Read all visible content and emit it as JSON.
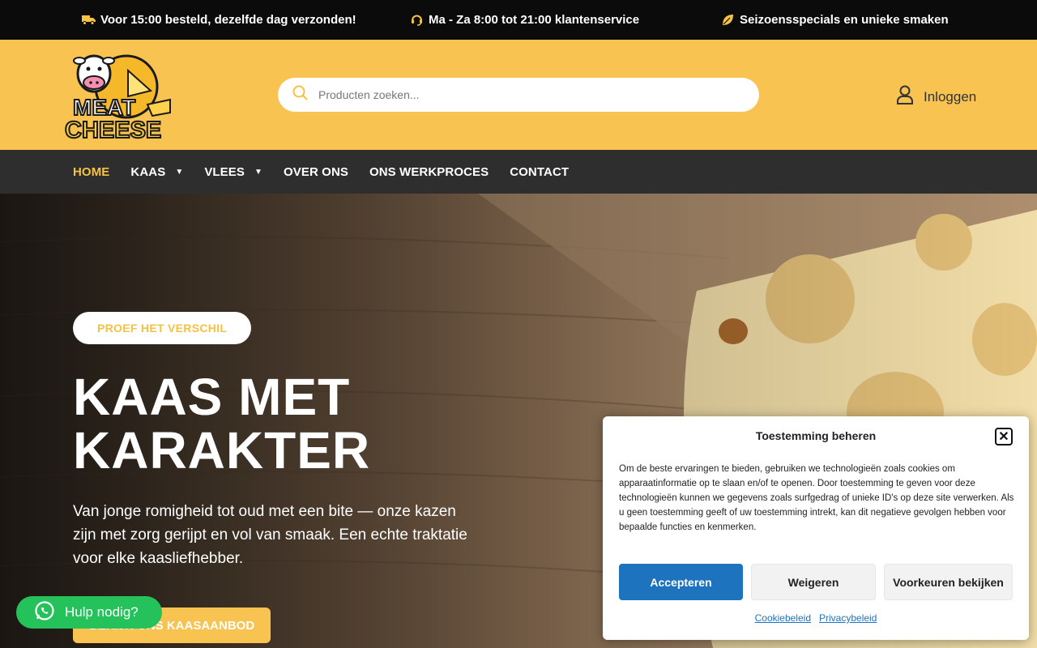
{
  "topbar": {
    "items": [
      {
        "icon": "truck-icon",
        "text": "Voor 15:00 besteld, dezelfde dag verzonden!"
      },
      {
        "icon": "headset-icon",
        "text": "Ma - Za 8:00 tot 21:00 klantenservice"
      },
      {
        "icon": "leaf-icon",
        "text": "Seizoensspecials en unieke smaken"
      }
    ]
  },
  "header": {
    "logo_text_top": "MEAT",
    "logo_text_bottom": "CHEESE",
    "search_placeholder": "Producten zoeken...",
    "login_label": "Inloggen"
  },
  "nav": {
    "items": [
      {
        "label": "HOME",
        "active": true,
        "dropdown": false
      },
      {
        "label": "KAAS",
        "active": false,
        "dropdown": true
      },
      {
        "label": "VLEES",
        "active": false,
        "dropdown": true
      },
      {
        "label": "OVER ONS",
        "active": false,
        "dropdown": false
      },
      {
        "label": "ONS WERKPROCES",
        "active": false,
        "dropdown": false
      },
      {
        "label": "CONTACT",
        "active": false,
        "dropdown": false
      }
    ]
  },
  "hero": {
    "badge": "PROEF HET VERSCHIL",
    "title_line1": "KAAS MET",
    "title_line2": "KARAKTER",
    "text": "Van jonge romigheid tot oud met een bite — onze kazen zijn met zorg gerijpt en vol van smaak. Een echte traktatie voor elke kaasliefhebber.",
    "cta_label": "BEKIJK ONS KAASAANBOD"
  },
  "help": {
    "label": "Hulp nodig?"
  },
  "consent": {
    "title": "Toestemming beheren",
    "text": "Om de beste ervaringen te bieden, gebruiken we technologieën zoals cookies om apparaatinformatie op te slaan en/of te openen. Door toestemming te geven voor deze technologieën kunnen we gegevens zoals surfgedrag of unieke ID's op deze site verwerken. Als u geen toestemming geeft of uw toestemming intrekt, kan dit negatieve gevolgen hebben voor bepaalde functies en kenmerken.",
    "accept_label": "Accepteren",
    "deny_label": "Weigeren",
    "prefs_label": "Voorkeuren bekijken",
    "cookie_policy_label": "Cookiebeleid",
    "privacy_policy_label": "Privacybeleid"
  },
  "colors": {
    "brand_yellow": "#f8c350",
    "accent_gold": "#f5c242",
    "nav_bg": "#2e2e2e",
    "topbar_bg": "#0b0b0b",
    "accept_blue": "#1e73be",
    "whatsapp_green": "#25c15a"
  }
}
